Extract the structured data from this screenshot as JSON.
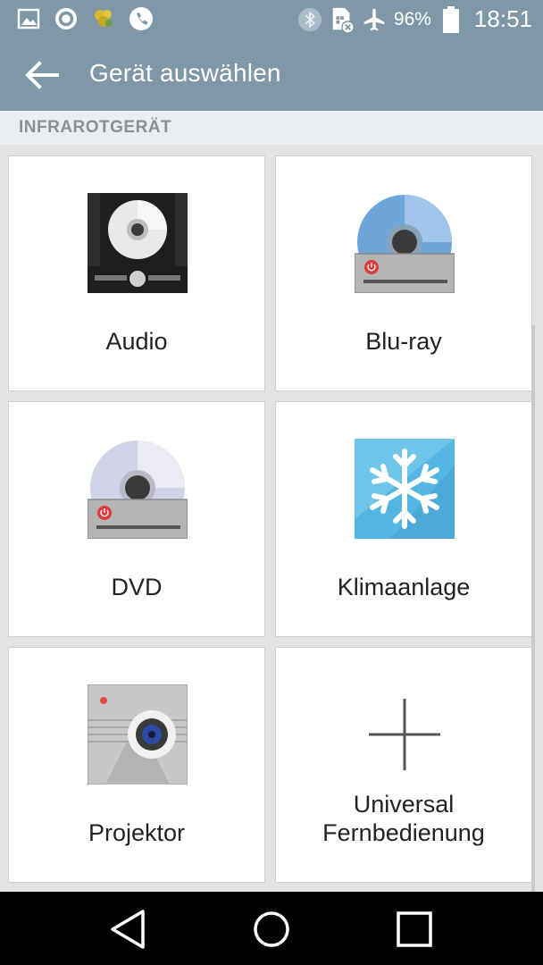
{
  "status_bar": {
    "battery_percent": "96%",
    "time": "18:51",
    "left_icons": [
      "image-icon",
      "app-circle-icon",
      "sunflower-icon",
      "phone-icon"
    ],
    "right_icons": [
      "bluetooth-icon",
      "sim-card-icon",
      "airplane-icon",
      "battery-icon"
    ]
  },
  "app_bar": {
    "title": "Gerät auswählen"
  },
  "section": {
    "header": "INFRAROTGERÄT"
  },
  "devices": [
    {
      "label": "Audio",
      "icon": "audio-device-icon"
    },
    {
      "label": "Blu-ray",
      "icon": "bluray-device-icon"
    },
    {
      "label": "DVD",
      "icon": "dvd-device-icon"
    },
    {
      "label": "Klimaanlage",
      "icon": "snowflake-icon"
    },
    {
      "label": "Projektor",
      "icon": "projector-icon"
    },
    {
      "label": "Universal Fernbedienung",
      "label_line1": "Universal",
      "label_line2": "Fernbedienung",
      "icon": "plus-icon"
    }
  ],
  "nav_bar": {
    "buttons": [
      "back-icon",
      "home-icon",
      "recents-icon"
    ]
  },
  "colors": {
    "app_bar": "#7e98a8",
    "section_bg": "#e8eef1",
    "section_text": "#8a8f93",
    "background": "#e3e3e3"
  }
}
